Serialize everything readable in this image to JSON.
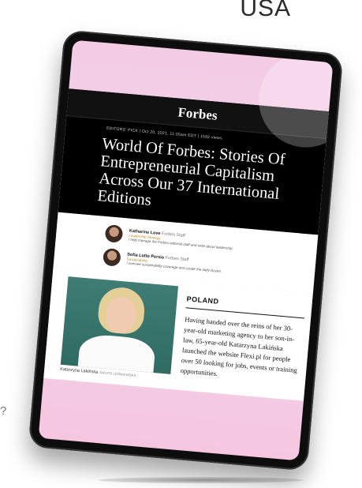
{
  "background": {
    "label": "USA",
    "question_mark": "?"
  },
  "article": {
    "logo": "Forbes",
    "meta": "EDITORS' PICK | Oct 20, 2021, 11:05am EDT | 1592 views",
    "headline": "World Of Forbes: Stories Of Entrepreneurial Capitalism Across Our 37 International Editions",
    "authors": [
      {
        "name": "Katharine Love",
        "affiliation": "Forbes Staff",
        "role": "Leadership Strategy",
        "description": "I help manage the Forbes editorial staff and write about leadership."
      },
      {
        "name": "Sofia Lotto Persio",
        "affiliation": "Forbes Staff",
        "role": "Sustainability",
        "description": "I oversee sustainability coverage and curate the daily Dozen."
      }
    ],
    "story": {
      "country": "POLAND",
      "body": "Having handed over the reins of her 30-year-old marketing agency to her son-in-law, 65-year-old Katarzyna Lakińska launched the website Flexi.pl for people over 50 looking for jobs, events or training opportunities.",
      "caption_name": "Katarzyna Lakińska",
      "caption_credit": "JAKUTA LEŚNIEWSKA"
    }
  },
  "colors": {
    "screen_pink": "#f3cce4",
    "article_bg": "#000000",
    "tablet_bezel": "#0d0d0d",
    "role_accent": "#b88a2a"
  }
}
